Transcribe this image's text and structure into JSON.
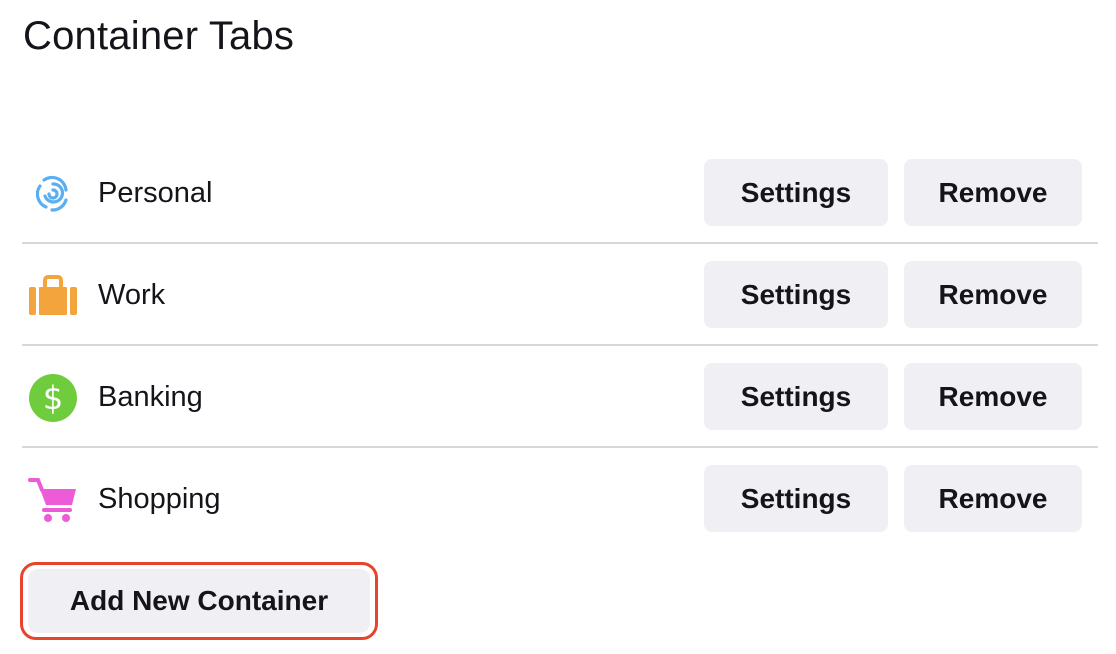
{
  "page": {
    "title": "Container Tabs"
  },
  "containers": [
    {
      "name": "Personal",
      "icon": "fingerprint-icon",
      "color": "#37adff",
      "settings_label": "Settings",
      "remove_label": "Remove"
    },
    {
      "name": "Work",
      "icon": "briefcase-icon",
      "color": "#f4a43c",
      "settings_label": "Settings",
      "remove_label": "Remove"
    },
    {
      "name": "Banking",
      "icon": "dollar-icon",
      "color": "#6fcd3d",
      "settings_label": "Settings",
      "remove_label": "Remove"
    },
    {
      "name": "Shopping",
      "icon": "cart-icon",
      "color": "#ee5bd8",
      "settings_label": "Settings",
      "remove_label": "Remove"
    }
  ],
  "actions": {
    "add_label": "Add New Container",
    "highlight_color": "#e8432c"
  }
}
